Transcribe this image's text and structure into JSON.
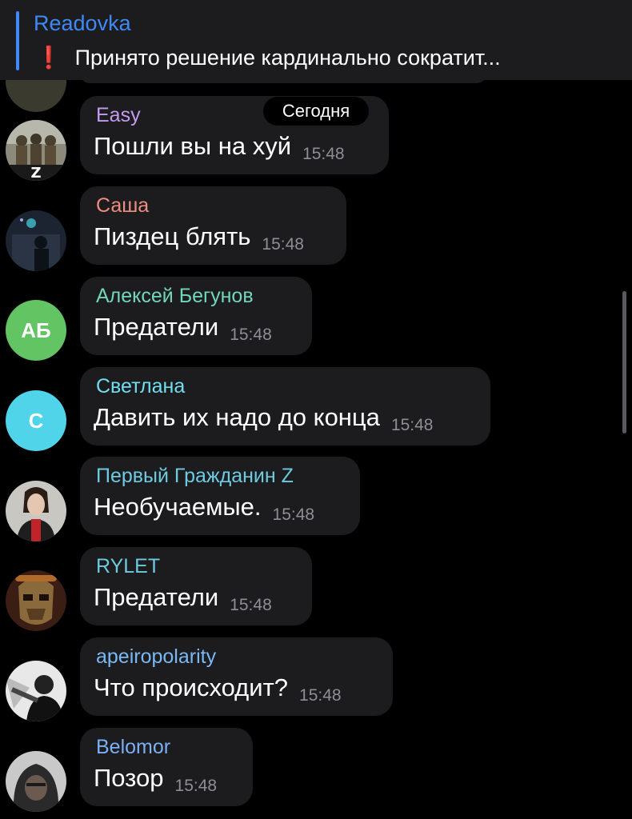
{
  "pinned": {
    "title": "Readovka",
    "icon": "❗",
    "text": "Принято решение кардинально сократит..."
  },
  "date_badge": "Сегодня",
  "messages": [
    {
      "name": "Easy",
      "name_color": "#c49bf0",
      "text": "Пошли вы на хуй",
      "time": "15:48",
      "avatar": "photo-soldiers"
    },
    {
      "name": "Саша",
      "name_color": "#ee8d7f",
      "text": "Пиздец блять",
      "time": "15:48",
      "avatar": "photo-dark-room"
    },
    {
      "name": "Алексей Бегунов",
      "name_color": "#72d6b8",
      "text": "Предатели",
      "time": "15:48",
      "avatar_initials": "АБ",
      "avatar_color": "#62c462"
    },
    {
      "name": "Светлана",
      "name_color": "#6fdff0",
      "text": "Давить их надо до конца",
      "time": "15:48",
      "avatar_initials": "С",
      "avatar_color": "#4fd4ea"
    },
    {
      "name": "Первый Гражданин Z",
      "name_color": "#6ccbe0",
      "text": "Необучаемые.",
      "time": "15:48",
      "avatar": "photo-man-red-shirt"
    },
    {
      "name": "RYLET",
      "name_color": "#6ccbe0",
      "text": "Предатели",
      "time": "15:48",
      "avatar": "photo-masked-figure"
    },
    {
      "name": "apeiropolarity",
      "name_color": "#7ab8f5",
      "text": "Что происходит?",
      "time": "15:48",
      "avatar": "photo-bw-figure"
    },
    {
      "name": "Belomor",
      "name_color": "#7ab0f5",
      "text": "Позор",
      "time": "15:48",
      "avatar": "photo-hooded-man"
    }
  ]
}
